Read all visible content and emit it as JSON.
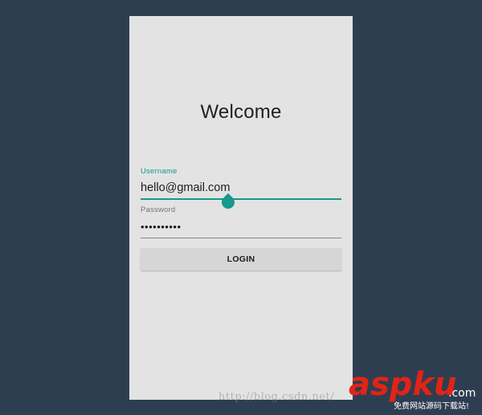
{
  "screen": {
    "title": "Welcome"
  },
  "form": {
    "username": {
      "label": "Username",
      "value": "hello@gmail.com"
    },
    "password": {
      "label": "Password",
      "value": "••••••••••"
    },
    "login_label": "LOGIN"
  },
  "watermark": {
    "url_text": "http://blog.csdn.net/"
  },
  "logo": {
    "brand": "aspku",
    "suffix": ".com",
    "tagline": "免费网站源码下载站!"
  },
  "colors": {
    "background": "#2e3e51",
    "card": "#e3e3e3",
    "accent": "#159a8b",
    "logo_red": "#e02417"
  }
}
